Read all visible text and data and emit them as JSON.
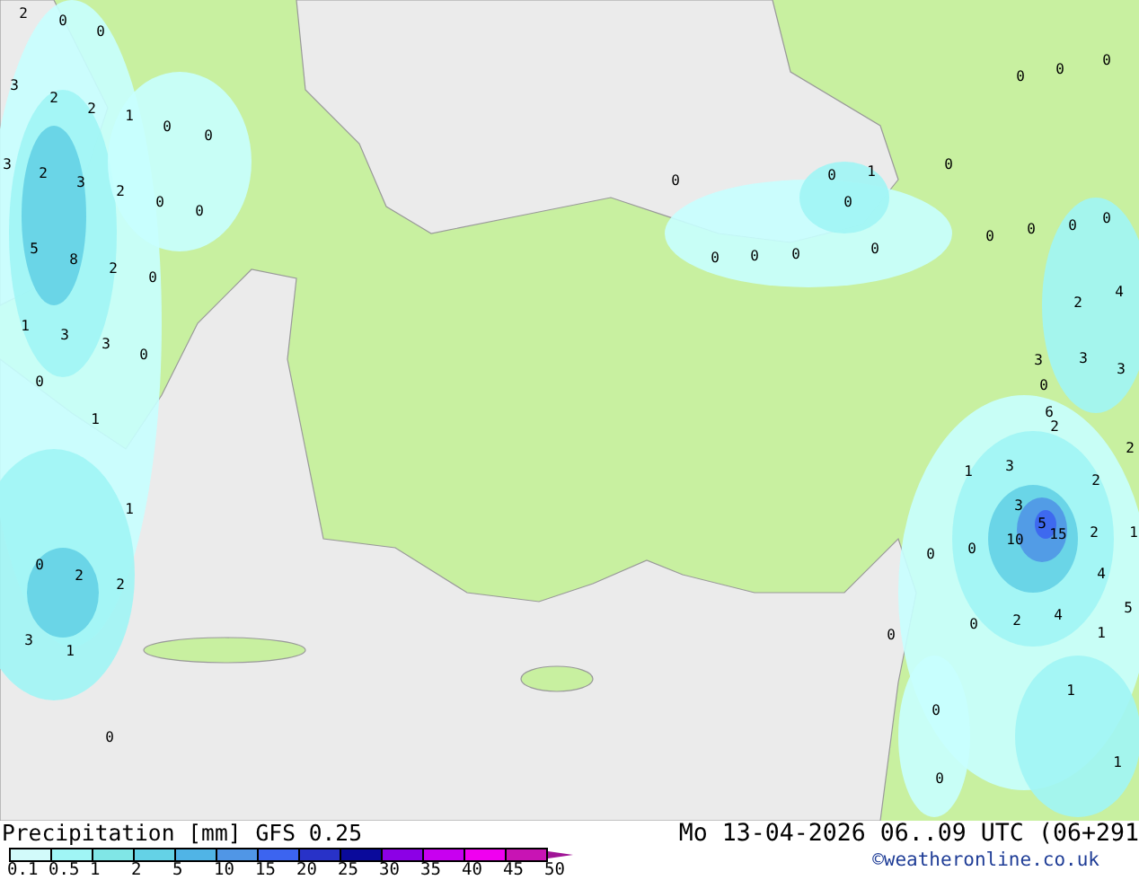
{
  "map": {
    "values": [
      "2",
      "0",
      "0",
      "3",
      "2",
      "2",
      "1",
      "0",
      "0",
      "3",
      "2",
      "3",
      "2",
      "0",
      "0",
      "5",
      "8",
      "2",
      "0",
      "1",
      "3",
      "3",
      "0",
      "0",
      "1",
      "1",
      "0",
      "2",
      "2",
      "3",
      "1",
      "0",
      "0",
      "0",
      "0",
      "0",
      "0",
      "0",
      "1",
      "0",
      "0",
      "0",
      "0",
      "0",
      "0",
      "0",
      "0",
      "0",
      "2",
      "4",
      "3",
      "3",
      "3",
      "0",
      "1",
      "3",
      "6",
      "2",
      "2",
      "3",
      "2",
      "5",
      "15",
      "10",
      "2",
      "1",
      "0",
      "0",
      "4",
      "5",
      "0",
      "2",
      "4",
      "0",
      "1",
      "1",
      "0",
      "0",
      "1"
    ]
  },
  "legend": {
    "title": "Precipitation [mm]",
    "model": "GFS 0.25",
    "swatches": [
      {
        "kind": "box",
        "color": "#d2fafa"
      },
      {
        "kind": "box",
        "color": "#a0f5f5"
      },
      {
        "kind": "box",
        "color": "#80e6e6"
      },
      {
        "kind": "box",
        "color": "#64d2e6"
      },
      {
        "kind": "box",
        "color": "#50b4e6"
      },
      {
        "kind": "box",
        "color": "#5096e6"
      },
      {
        "kind": "box",
        "color": "#3c64f0"
      },
      {
        "kind": "box",
        "color": "#2832c8"
      },
      {
        "kind": "box",
        "color": "#0a0a9b"
      },
      {
        "kind": "box",
        "color": "#8c00e6"
      },
      {
        "kind": "box",
        "color": "#c800f0"
      },
      {
        "kind": "box",
        "color": "#f000f0"
      },
      {
        "kind": "box",
        "color": "#c814b4"
      },
      {
        "kind": "arrow",
        "color": "#a01496"
      }
    ],
    "ticks": [
      "0.1",
      "0.5",
      "1",
      "2",
      "5",
      "10",
      "15",
      "20",
      "25",
      "30",
      "35",
      "40",
      "45",
      "50"
    ]
  },
  "valid_time": "Mo 13-04-2026 06..09 UTC (06+291",
  "credit": "©weatheronline.co.uk"
}
